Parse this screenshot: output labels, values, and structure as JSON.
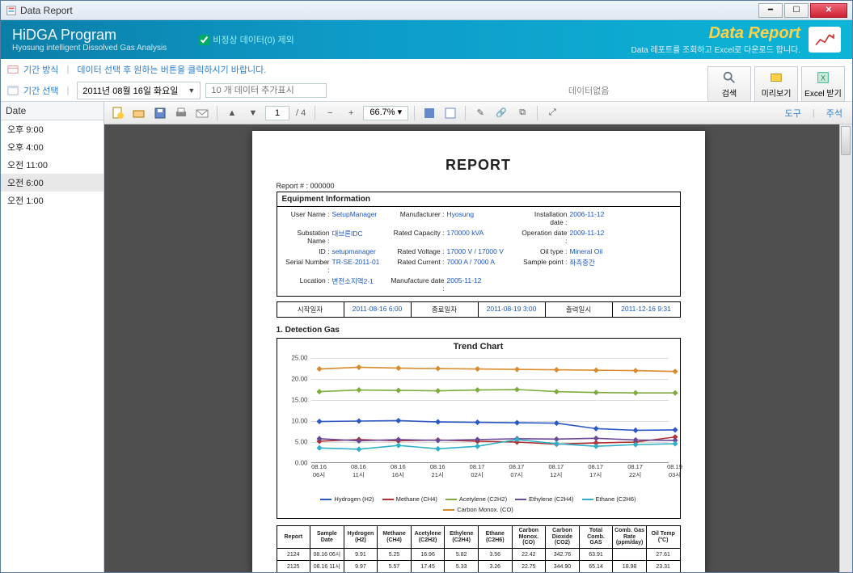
{
  "window": {
    "title": "Data Report"
  },
  "banner": {
    "program": "HiDGA Program",
    "sub": "Hyosung intelligent Dissolved Gas Analysis",
    "checkbox": "비정상 데이터(0) 제외",
    "title": "Data Report",
    "desc": "Data 레포트를 조회하고 Excel로 다운로드 합니다."
  },
  "subhead": {
    "mode": "기간 방식",
    "note": "데이터 선택 후 원하는 버튼을 클릭하시기 바랍니다.",
    "period_label": "기간 선택",
    "date": "2011년 08월 16일 화요일",
    "count_placeholder": "10 개 데이터 추가표시",
    "status": "데이터없음"
  },
  "actions": {
    "search": "검색",
    "preview": "미리보기",
    "excel": "Excel 받기"
  },
  "sidebar": {
    "header": "Date",
    "items": [
      "오후 9:00",
      "오후 4:00",
      "오전 11:00",
      "오전 6:00",
      "오전 1:00"
    ],
    "selected": 3
  },
  "viewer": {
    "page_current": "1",
    "page_total": "/ 4",
    "zoom": "66.7%",
    "tool": "도구",
    "annot": "주석"
  },
  "report": {
    "heading": "REPORT",
    "number": "Report # : 000000",
    "eq_header": "Equipment Information",
    "eq": [
      [
        "User Name :",
        "SetupManager",
        "Manufacturer :",
        "Hyosung",
        "Installation date :",
        "2006-11-12"
      ],
      [
        "Substation Name :",
        "대브론IDC",
        "Rated Capacity :",
        "170000 kVA",
        "Operation date :",
        "2009-11-12"
      ],
      [
        "ID :",
        "setupmanager",
        "Rated Voltage :",
        "17000 V / 17000 V",
        "Oil type :",
        "Mineral Oil"
      ],
      [
        "Serial Number :",
        "TR-SE-2011-01",
        "Rated Current :",
        "7000 A / 7000 A",
        "Sample point :",
        "좌측중간"
      ],
      [
        "Location :",
        "변전소지역2-1",
        "Manufacture date :",
        "2005-11-12",
        "",
        ""
      ]
    ],
    "dates": {
      "labels": [
        "시작일자",
        "종료일자",
        "출력일시"
      ],
      "values": [
        "2011-08-16 6:00",
        "2011-08-19 3:00",
        "2011-12-16 9:31"
      ]
    },
    "section1": "1. Detection Gas",
    "chart_title": "Trend Chart",
    "table_headers": [
      "Report",
      "Sample Date",
      "Hydrogen (H2)",
      "Methane (CH4)",
      "Acetylene (C2H2)",
      "Ethylene (C2H4)",
      "Ethane (C2H6)",
      "Carbon Monox. (CO)",
      "Carbon Dioxide (CO2)",
      "Total Comb. GAS",
      "Comb. Gas Rate (ppm/day)",
      "Oil Temp (°C)"
    ],
    "table_rows": [
      [
        "2124",
        "08.16 06시",
        "9.91",
        "5.25",
        "16.96",
        "5.82",
        "3.56",
        "22.42",
        "342.76",
        "63.91",
        "",
        "27.61"
      ],
      [
        "2125",
        "08.16 11시",
        "9.97",
        "5.57",
        "17.45",
        "5.33",
        "3.26",
        "22.75",
        "344.90",
        "65.14",
        "18.98",
        "23.31"
      ]
    ]
  },
  "chart_data": {
    "type": "line",
    "title": "Trend Chart",
    "ylim": [
      0,
      25
    ],
    "yticks": [
      0,
      5,
      10,
      15,
      20,
      25
    ],
    "categories": [
      "08.16 06시",
      "08.16 11시",
      "08.16 16시",
      "08.16 21시",
      "08.17 02시",
      "08.17 07시",
      "08.17 12시",
      "08.17 17시",
      "08.17 22시",
      "08.19 03시"
    ],
    "series": [
      {
        "name": "Hydrogen (H2)",
        "color": "#2b58c4",
        "values": [
          9.9,
          10.0,
          10.1,
          9.8,
          9.7,
          9.6,
          9.5,
          8.2,
          7.8,
          7.9
        ]
      },
      {
        "name": "Methane (CH4)",
        "color": "#b23030",
        "values": [
          5.2,
          5.6,
          5.3,
          5.5,
          5.2,
          5.0,
          4.5,
          4.8,
          5.0,
          6.2
        ]
      },
      {
        "name": "Acetylene (C2H2)",
        "color": "#7dab3d",
        "values": [
          17.0,
          17.4,
          17.3,
          17.2,
          17.4,
          17.5,
          17.0,
          16.8,
          16.7,
          16.7
        ]
      },
      {
        "name": "Ethylene (C2H4)",
        "color": "#6a4898",
        "values": [
          5.8,
          5.3,
          5.6,
          5.4,
          5.6,
          5.8,
          5.7,
          5.9,
          5.5,
          5.4
        ]
      },
      {
        "name": "Ethane (C2H6)",
        "color": "#2fb0c8",
        "values": [
          3.6,
          3.3,
          4.2,
          3.4,
          4.0,
          5.6,
          4.6,
          4.0,
          4.4,
          4.6
        ]
      },
      {
        "name": "Carbon Monox. (CO)",
        "color": "#d98a2b",
        "values": [
          22.4,
          22.8,
          22.6,
          22.5,
          22.4,
          22.3,
          22.2,
          22.1,
          22.0,
          21.8
        ]
      }
    ]
  }
}
